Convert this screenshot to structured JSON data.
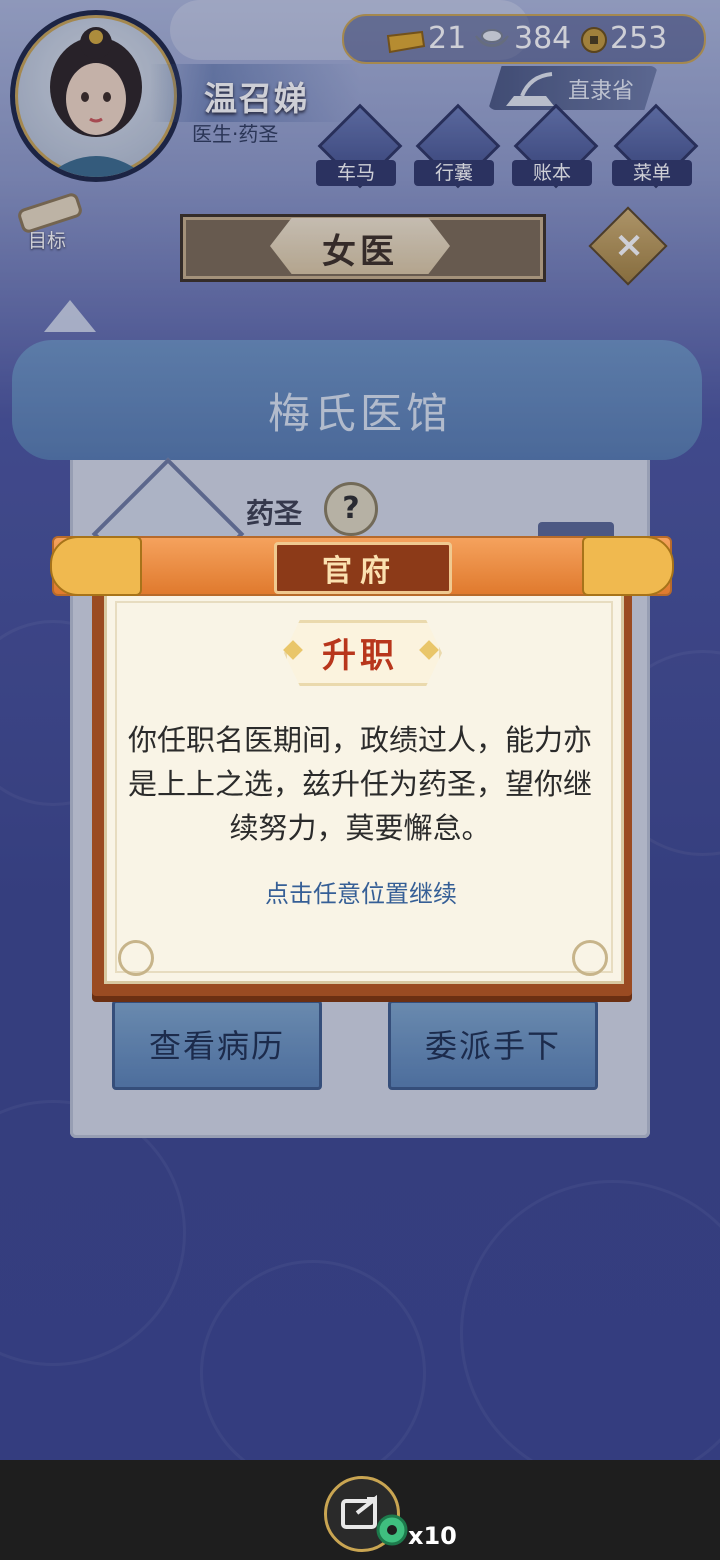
{
  "top": {
    "player_name": "温召娣",
    "player_title": "医生·药圣",
    "currency": {
      "gold": "21",
      "silver": "384",
      "coin": "253"
    },
    "province": "直隶省",
    "menu": [
      "车马",
      "行囊",
      "账本",
      "菜单"
    ],
    "goal_label": "目标"
  },
  "header": {
    "title": "女医"
  },
  "clinic": {
    "name": "梅氏医馆",
    "rank": "药圣",
    "help": "?",
    "buttons": [
      "查看病历",
      "委派手下"
    ]
  },
  "modal": {
    "banner": "官府",
    "subtitle": "升职",
    "body": "你任职名医期间，政绩过人，能力亦是上上之选，兹升任为药圣，望你继续努力，莫要懈怠。",
    "hint": "点击任意位置继续"
  },
  "bottom": {
    "reward_count": "x10"
  },
  "colors": {
    "accent_gold": "#c9a552",
    "banner_orange": "#e07a2e",
    "frame_brown": "#9a4b22",
    "hint_blue": "#365f96"
  }
}
